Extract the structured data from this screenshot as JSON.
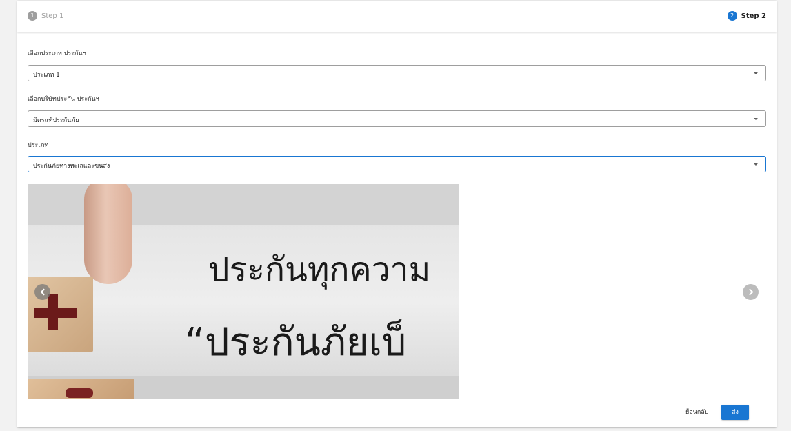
{
  "stepper": {
    "steps": [
      {
        "number": "1",
        "label": "Step 1",
        "state": "inactive"
      },
      {
        "number": "2",
        "label": "Step 2",
        "state": "active"
      }
    ]
  },
  "form": {
    "insurance_type": {
      "label": "เลือกประเภท ประกันฯ",
      "value": "ประเภท 1"
    },
    "insurance_company": {
      "label": "เลือกบริษัทประกัน ประกันฯ",
      "value": "มิตรแท้ประกันภัย"
    },
    "category": {
      "label": "ประเภท",
      "value": "ประกันภัยทางทะเลและขนส่ง"
    }
  },
  "carousel": {
    "slide_text_line1": "ประกันทุกความ",
    "slide_text_line2": "“ประกันภัยเบ็"
  },
  "actions": {
    "back_label": "ย้อนกลับ",
    "send_label": "ส่ง"
  },
  "colors": {
    "primary": "#1976d2",
    "inactive": "#9e9e9e"
  },
  "icons": {
    "select_caret": "caret-down-icon",
    "carousel_prev": "chevron-left-icon",
    "carousel_next": "chevron-right-icon"
  }
}
